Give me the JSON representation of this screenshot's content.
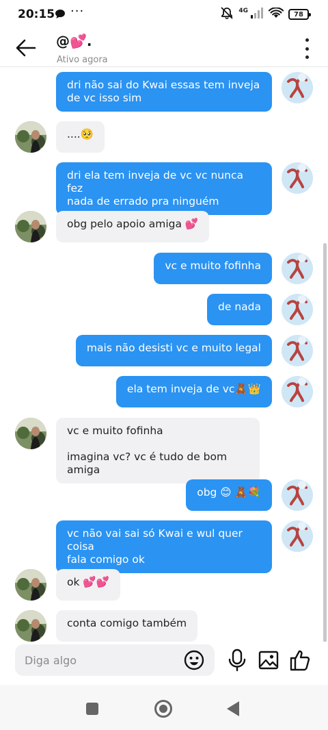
{
  "status_bar": {
    "time": "20:15",
    "dots": "···",
    "network": "4G",
    "battery": "78"
  },
  "header": {
    "contact_name": "@💕.",
    "contact_status": "Ativo agora"
  },
  "messages": [
    {
      "from": "me",
      "text": "dri não sai do Kwai essas tem inveja\nde vc isso sim"
    },
    {
      "from": "them",
      "text": "....🥺"
    },
    {
      "from": "me",
      "text": "dri ela tem inveja de vc vc nunca fez\nnada de errado pra ninguém"
    },
    {
      "from": "them",
      "text": "obg pelo apoio amiga 💕"
    },
    {
      "from": "me",
      "text": "vc e muito fofinha"
    },
    {
      "from": "me",
      "text": "de nada"
    },
    {
      "from": "me",
      "text": "mais não desisti vc e muito legal"
    },
    {
      "from": "me",
      "text": "ela tem inveja de vc🧸👑"
    },
    {
      "from": "them",
      "text": "vc e muito fofinha\n\nimagina vc? vc é tudo de bom amiga"
    },
    {
      "from": "me",
      "text": "obg 😊 🧸💐"
    },
    {
      "from": "me",
      "text": "vc não vai sai só Kwai e wul quer coisa\nfala comigo ok"
    },
    {
      "from": "them",
      "text": "ok 💕💕"
    },
    {
      "from": "them",
      "text": "conta comigo também"
    }
  ],
  "composer": {
    "placeholder": "Diga algo"
  },
  "icons": {
    "back": "arrow-left-icon",
    "more": "more-vertical-icon",
    "emoji": "emoji-icon",
    "mic": "microphone-icon",
    "gallery": "image-icon",
    "like": "thumbs-up-icon"
  },
  "colors": {
    "outgoing_bubble": "#2b93f2",
    "incoming_bubble": "#f1f1f3"
  }
}
